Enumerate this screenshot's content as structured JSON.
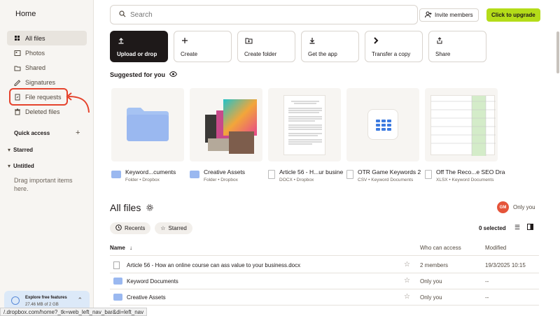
{
  "sidebar": {
    "home": "Home",
    "items": [
      {
        "label": "All files",
        "icon": "all-files-icon"
      },
      {
        "label": "Photos",
        "icon": "photos-icon"
      },
      {
        "label": "Shared",
        "icon": "shared-icon"
      },
      {
        "label": "Signatures",
        "icon": "signatures-icon"
      },
      {
        "label": "File requests",
        "icon": "file-requests-icon"
      },
      {
        "label": "Deleted files",
        "icon": "deleted-files-icon"
      }
    ],
    "quick_access": "Quick access",
    "starred": "Starred",
    "untitled": "Untitled",
    "drag_hint": "Drag important items here.",
    "explore_title": "Explore free features",
    "explore_storage": "27.46 MB of 2 GB",
    "status_url": "/.dropbox.com/home?_tk=web_left_nav_bar&di=left_nav"
  },
  "header": {
    "search_placeholder": "Search",
    "invite_label": "Invite members",
    "upgrade_label": "Click to upgrade"
  },
  "actions": [
    {
      "label": "Upload or drop",
      "icon": "upload-icon"
    },
    {
      "label": "Create",
      "icon": "plus-icon"
    },
    {
      "label": "Create folder",
      "icon": "folder-plus-icon"
    },
    {
      "label": "Get the app",
      "icon": "download-icon"
    },
    {
      "label": "Transfer a copy",
      "icon": "transfer-icon"
    },
    {
      "label": "Share",
      "icon": "share-icon"
    }
  ],
  "suggested": {
    "title": "Suggested for you",
    "cards": [
      {
        "name": "Keyword...cuments",
        "meta": "Folder • Dropbox"
      },
      {
        "name": "Creative Assets",
        "meta": "Folder • Dropbox"
      },
      {
        "name": "Article 56 - H...ur busine",
        "meta": "DOCX • Dropbox"
      },
      {
        "name": "OTR Game Keywords 2",
        "meta": "CSV • Keyword Documents"
      },
      {
        "name": "Off The Reco...e SEO Dra",
        "meta": "XLSX • Keyword Documents"
      }
    ]
  },
  "allfiles": {
    "title": "All files",
    "avatar_initials": "GM",
    "only_you": "Only you",
    "chip_recents": "Recents",
    "chip_starred": "Starred",
    "selected": "0 selected",
    "col_name": "Name",
    "col_access": "Who can access",
    "col_modified": "Modified",
    "rows": [
      {
        "name": "Article 56 - How an online course can ass value to your business.docx",
        "access": "2 members",
        "modified": "19/3/2025 10:15"
      },
      {
        "name": "Keyword Documents",
        "access": "Only you",
        "modified": "--"
      },
      {
        "name": "Creative Assets",
        "access": "Only you",
        "modified": "--"
      }
    ]
  },
  "colors": {
    "accent_upgrade": "#b4dc19",
    "highlight_red": "#e5432d",
    "folder_blue": "#9ab8f0",
    "primary_dark": "#1e1919"
  }
}
